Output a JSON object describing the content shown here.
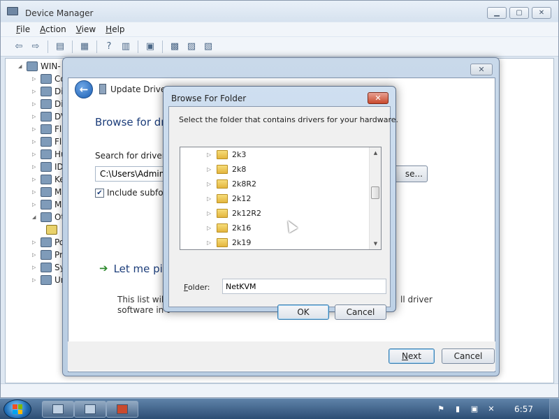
{
  "device_manager": {
    "title": "Device Manager",
    "menu": [
      {
        "label": "File",
        "key": "F",
        "rest": "ile"
      },
      {
        "label": "Action",
        "key": "A",
        "rest": "ction"
      },
      {
        "label": "View",
        "key": "V",
        "rest": "iew"
      },
      {
        "label": "Help",
        "key": "H",
        "rest": "elp"
      }
    ],
    "tree_root": "WIN-",
    "tree_nodes": [
      "Co",
      "Di",
      "Di",
      "DV",
      "Fl",
      "Fl",
      "Hu",
      "ID",
      "Ke",
      "M",
      "M",
      "Ot",
      "",
      "Po",
      "Pr",
      "Sy",
      "Ur"
    ]
  },
  "update_driver": {
    "title": "Update Driver So",
    "close_glyph": "✕",
    "heading": "Browse for dri",
    "search_label": "Search for driver so",
    "path_value": "C:\\Users\\Adminis",
    "browse_label": "se...",
    "include_subfolders": "Include subfold",
    "letme_title": "Let me pi",
    "letme_desc": "This list will s",
    "letme_desc2": "software in t",
    "letme_desc_right": "ll driver",
    "next_label": "Next",
    "next_key": "N",
    "next_rest": "ext",
    "cancel_label": "Cancel"
  },
  "browse_folder": {
    "title": "Browse For Folder",
    "close_glyph": "✕",
    "instruction": "Select the folder that contains drivers for your hardware.",
    "folders": [
      "2k3",
      "2k8",
      "2k8R2",
      "2k12",
      "2k12R2",
      "2k16",
      "2k19"
    ],
    "folder_label": "Folder:",
    "folder_label_key": "F",
    "folder_label_rest": "older:",
    "folder_value": "NetKVM",
    "ok_label": "OK",
    "cancel_label": "Cancel"
  },
  "taskbar": {
    "clock": "6:57"
  }
}
